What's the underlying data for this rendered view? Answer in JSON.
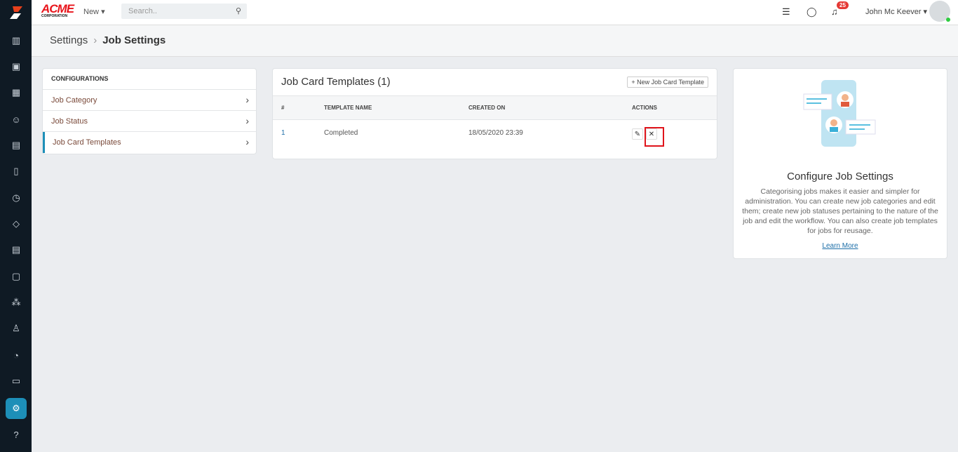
{
  "header": {
    "brand": "ACME",
    "brand_sub": "CORPORATION",
    "new_label": "New",
    "search_placeholder": "Search..",
    "notification_count": "25",
    "user_name": "John Mc Keever"
  },
  "breadcrumb": {
    "parent": "Settings",
    "current": "Job Settings"
  },
  "config": {
    "title": "CONFIGURATIONS",
    "items": [
      {
        "label": "Job Category"
      },
      {
        "label": "Job Status"
      },
      {
        "label": "Job Card Templates"
      }
    ]
  },
  "templates": {
    "title": "Job Card Templates (1)",
    "new_button": "New Job Card Template",
    "columns": [
      "#",
      "TEMPLATE NAME",
      "CREATED ON",
      "ACTIONS"
    ],
    "rows": [
      {
        "num": "1",
        "name": "Completed",
        "created": "18/05/2020 23:39"
      }
    ]
  },
  "info": {
    "title": "Configure Job Settings",
    "text": "Categorising jobs makes it easier and simpler for administration. You can create new job categories and edit them; create new job statuses pertaining to the nature of the job and edit the workflow. You can also create job templates for jobs for reusage.",
    "link": "Learn More"
  }
}
